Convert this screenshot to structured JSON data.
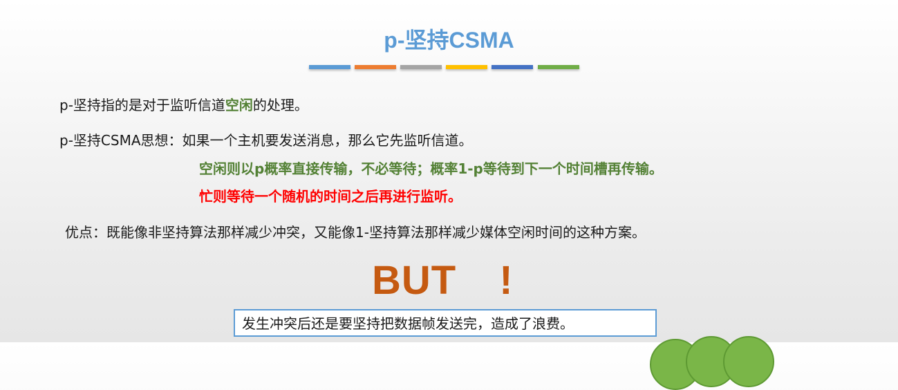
{
  "slide": {
    "title": "p-坚持CSMA",
    "title_color": "#5b9bd5",
    "accent_bars": [
      {
        "color": "#5b9bd5"
      },
      {
        "color": "#ed7d31"
      },
      {
        "color": "#a5a5a5"
      },
      {
        "color": "#ffc000"
      },
      {
        "color": "#4472c4"
      },
      {
        "color": "#70ad47"
      }
    ]
  },
  "content": {
    "line1": {
      "before": "p-坚持指的是对于监听信道",
      "highlight": "空闲",
      "after": "的处理。"
    },
    "line2": "p-坚持CSMA思想：如果一个主机要发送消息，那么它先监听信道。",
    "line3": "空闲则以p概率直接传输，不必等待；概率1-p等待到下一个时间槽再传输。",
    "line4": "忙则等待一个随机的时间之后再进行监听。",
    "line5": "优点：既能像非坚持算法那样减少冲突，又能像1-坚持算法那样减少媒体空闲时间的这种方案。"
  },
  "but": {
    "word": "BUT",
    "mark": "!",
    "color": "#c55a11"
  },
  "note": {
    "text": "发生冲突后还是要坚持把数据帧发送完，造成了浪费。"
  },
  "colors": {
    "green_emphasis": "#538135",
    "red_emphasis": "#ff0000",
    "box_border": "#5b9bd5",
    "decoration_green": "#7ab648"
  }
}
